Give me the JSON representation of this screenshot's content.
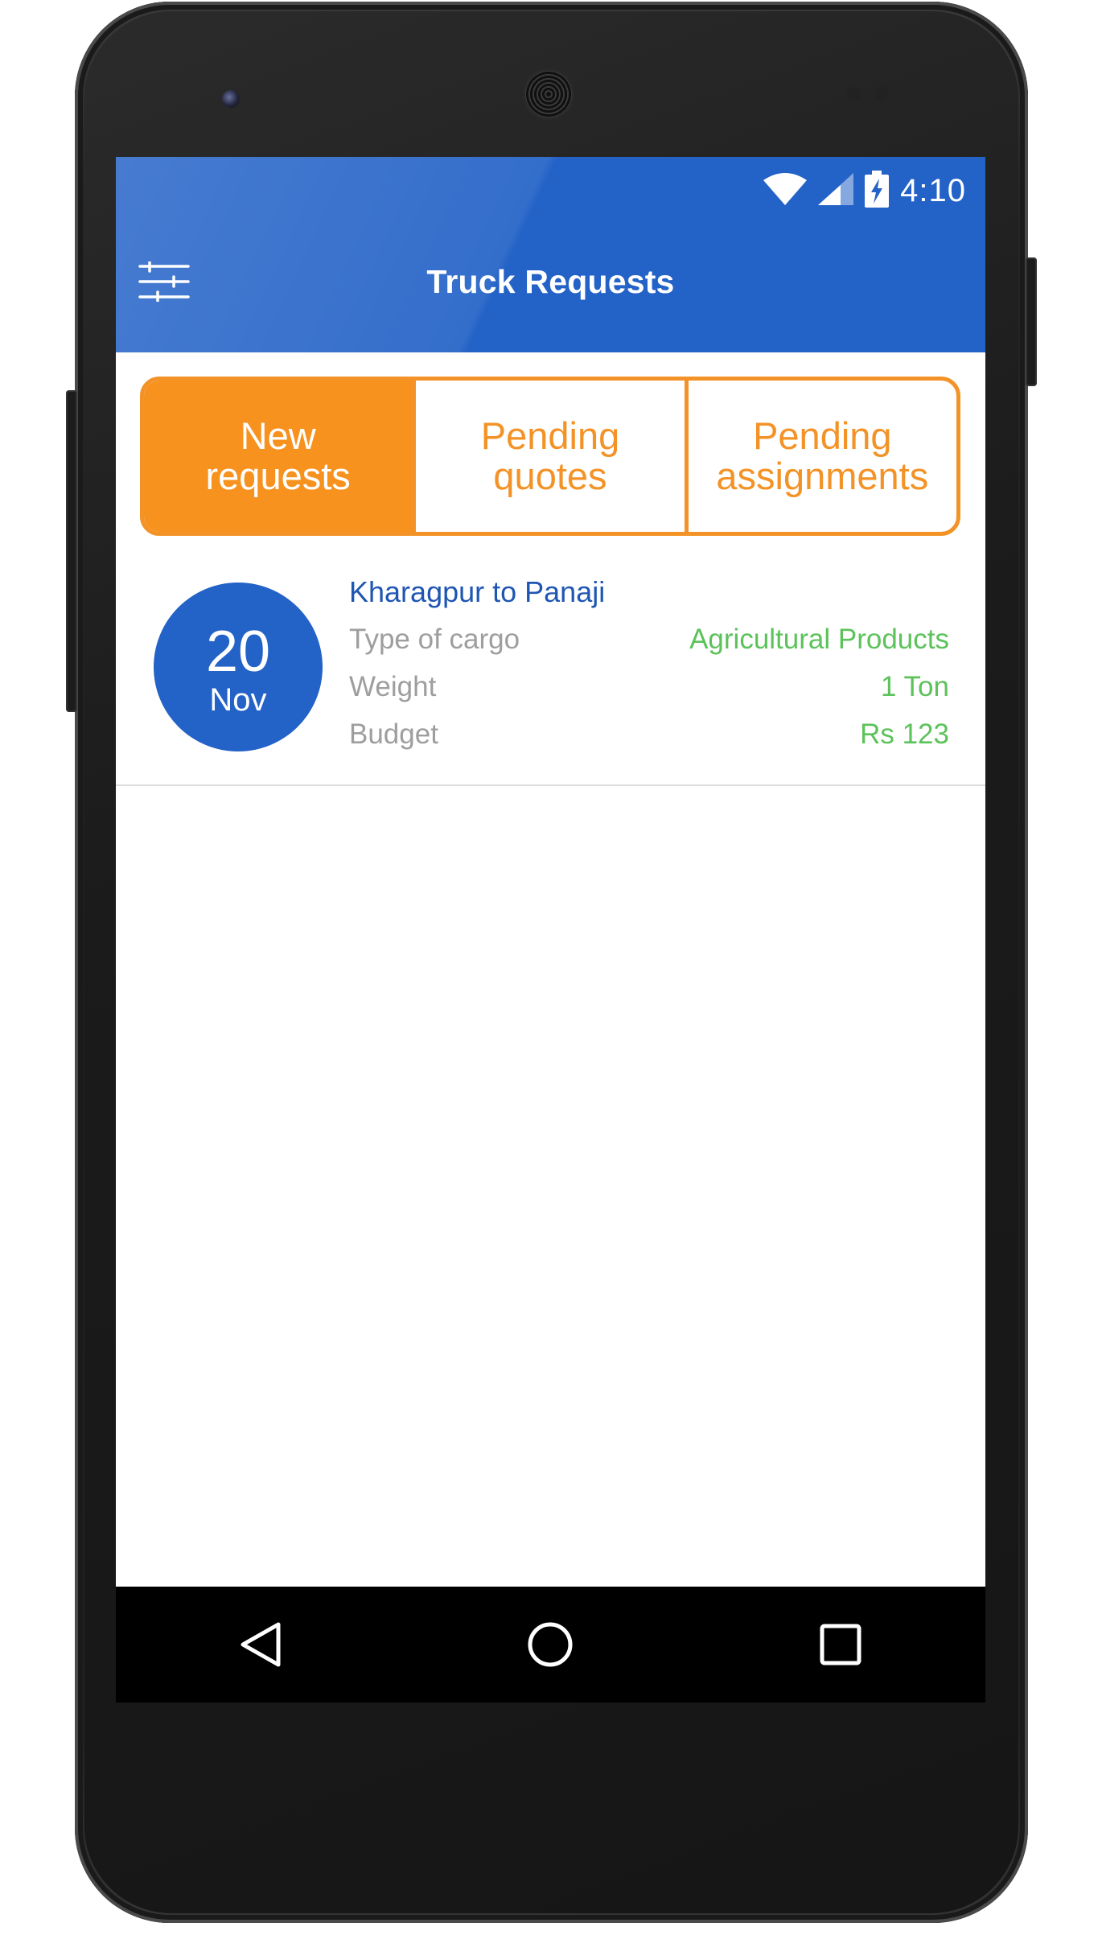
{
  "status_bar": {
    "time": "4:10",
    "icons": [
      "wifi-icon",
      "cellular-signal-icon",
      "battery-charging-icon"
    ]
  },
  "app_bar": {
    "title": "Truck Requests",
    "menu_icon": "filter-sliders-icon"
  },
  "tabs": [
    {
      "line1": "New",
      "line2": "requests",
      "active": true
    },
    {
      "line1": "Pending",
      "line2": "quotes",
      "active": false
    },
    {
      "line1": "Pending",
      "line2": "assignments",
      "active": false
    }
  ],
  "requests": [
    {
      "date_day": "20",
      "date_month": "Nov",
      "route": "Kharagpur to Panaji",
      "details": [
        {
          "label": "Type of cargo",
          "value": "Agricultural Products"
        },
        {
          "label": "Weight",
          "value": "1 Ton"
        },
        {
          "label": "Budget",
          "value": "Rs 123"
        }
      ]
    }
  ],
  "nav_bar": {
    "buttons": [
      "back-icon",
      "home-icon",
      "recents-icon"
    ]
  },
  "colors": {
    "primary": "#2362c7",
    "accent_orange": "#f39327",
    "value_green": "#5cc25a",
    "label_gray": "#9e9e9e",
    "route_blue": "#1f56b3"
  }
}
